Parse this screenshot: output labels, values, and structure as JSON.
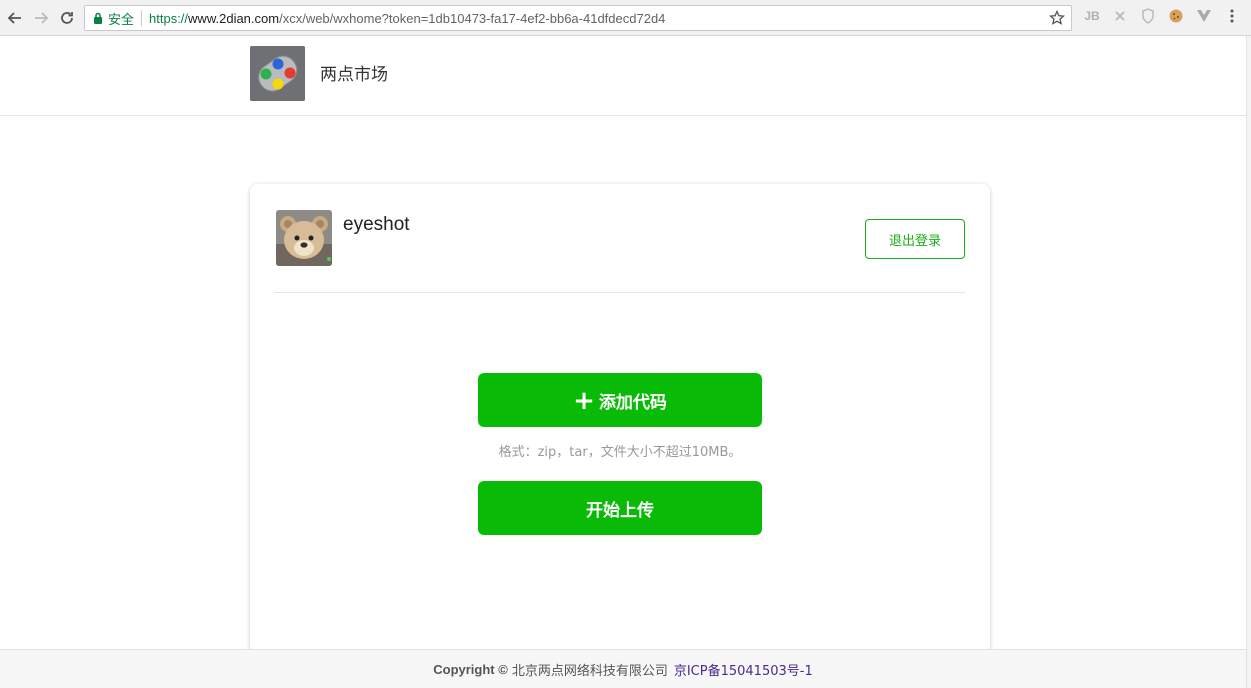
{
  "browser": {
    "secure_label": "安全",
    "url_scheme": "https://",
    "url_host": "www.2dian.com",
    "url_path": "/xcx/web/wxhome?token=1db10473-fa17-4ef2-bb6a-41dfdecd72d4",
    "extensions": [
      "JB",
      "ext-cross-icon",
      "shield-icon",
      "cookie-icon",
      "vue-icon"
    ]
  },
  "header": {
    "site_title": "两点市场"
  },
  "user": {
    "name": "eyeshot",
    "logout_label": "退出登录"
  },
  "actions": {
    "add_code_label": "添加代码",
    "format_hint": "格式：zip，tar，文件大小不超过10MB。",
    "upload_label": "开始上传"
  },
  "footer": {
    "copyright": "Copyright ©",
    "company": "北京两点网络科技有限公司",
    "icp": "京ICP备15041503号-1"
  },
  "colors": {
    "accent_green": "#09bb07",
    "outline_green": "#1aad19",
    "link_purple": "#4a2b8a"
  }
}
